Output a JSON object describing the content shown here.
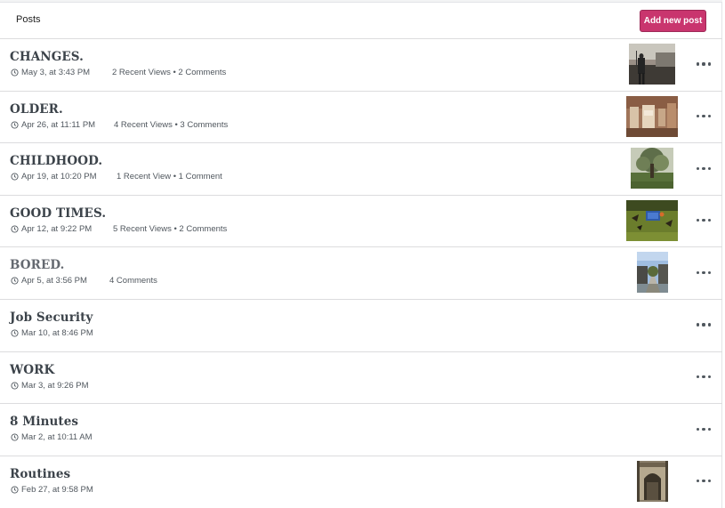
{
  "header": {
    "title": "Posts",
    "add_button": "Add new post"
  },
  "colors": {
    "accent": "#c9356e",
    "title": "#3c434a",
    "meta": "#50575e"
  },
  "posts": [
    {
      "title": "CHANGES.",
      "date": "May 3, at 3:43 PM",
      "stats": "2 Recent Views • 2 Comments",
      "thumbnail": "person-sunset-photo"
    },
    {
      "title": "OLDER.",
      "date": "Apr 26, at 11:11 PM",
      "stats": "4 Recent Views • 3 Comments",
      "thumbnail": "interior-room-photo"
    },
    {
      "title": "CHILDHOOD.",
      "date": "Apr 19, at 10:20 PM",
      "stats": "1 Recent View • 1 Comment",
      "thumbnail": "tree-yard-photo"
    },
    {
      "title": "GOOD TIMES.",
      "date": "Apr 12, at 9:22 PM",
      "stats": "5 Recent Views • 2 Comments",
      "thumbnail": "field-sign-photo"
    },
    {
      "title": "BORED.",
      "date": "Apr 5, at 3:56 PM",
      "stats": "4 Comments",
      "thumbnail": "campus-path-photo"
    },
    {
      "title": "Job Security",
      "date": "Mar 10, at 8:46 PM",
      "stats": "",
      "thumbnail": ""
    },
    {
      "title": "WORK",
      "date": "Mar 3, at 9:26 PM",
      "stats": "",
      "thumbnail": ""
    },
    {
      "title": "8 Minutes",
      "date": "Mar 2, at 10:11 AM",
      "stats": "",
      "thumbnail": ""
    },
    {
      "title": "Routines",
      "date": "Feb 27, at 9:58 PM",
      "stats": "",
      "thumbnail": "archway-photo"
    }
  ]
}
